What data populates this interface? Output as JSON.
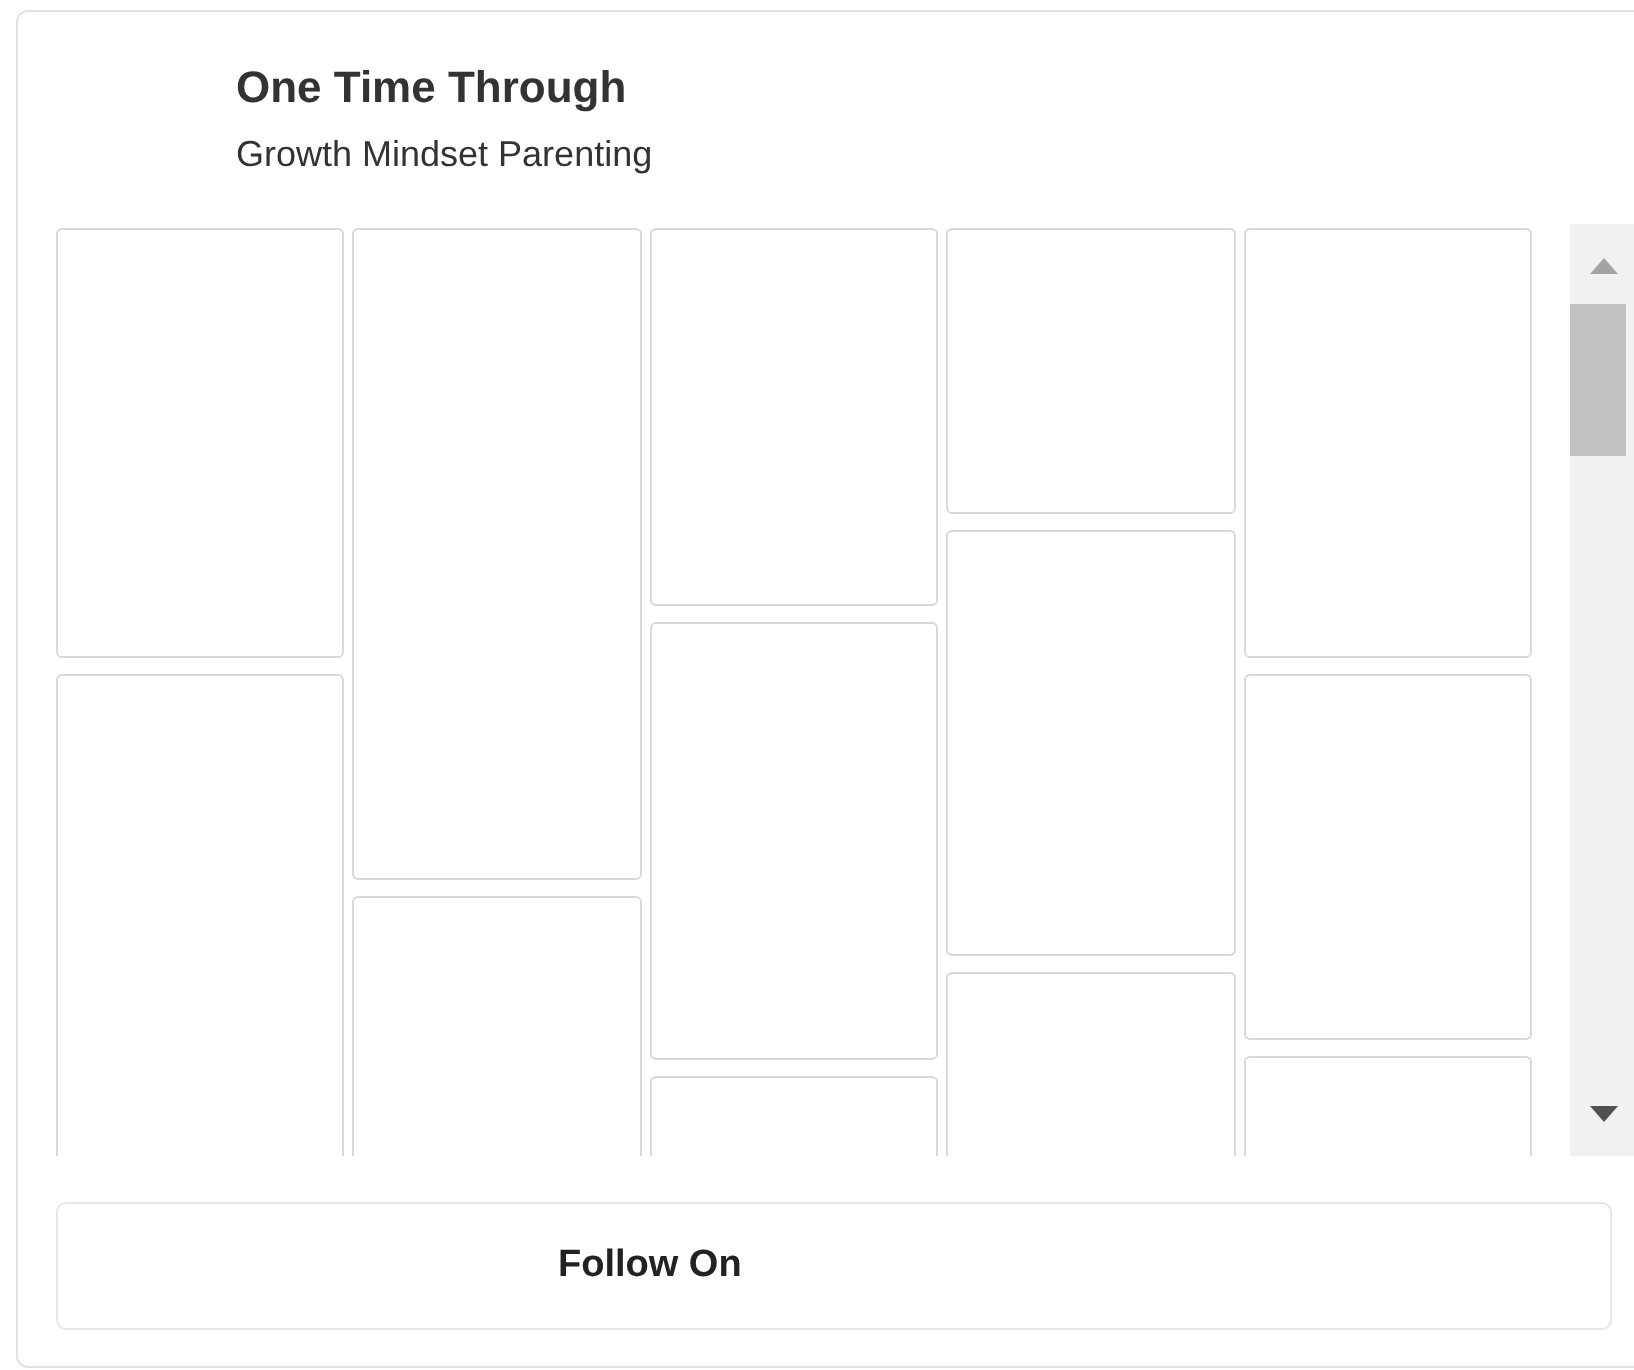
{
  "header": {
    "title": "One Time Through",
    "subtitle": "Growth Mindset Parenting"
  },
  "follow_button": {
    "label": "Follow On"
  }
}
